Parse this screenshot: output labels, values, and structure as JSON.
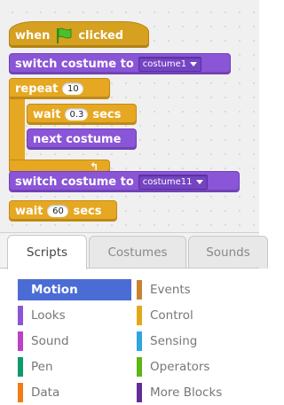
{
  "script": {
    "hat": {
      "when": "when",
      "clicked": "clicked"
    },
    "switch1": {
      "label": "switch costume to",
      "costume": "costume1"
    },
    "repeat": {
      "label": "repeat",
      "count": "10"
    },
    "wait_inner": {
      "label": "wait",
      "value": "0.3",
      "unit": "secs"
    },
    "next_costume": {
      "label": "next costume"
    },
    "switch2": {
      "label": "switch costume to",
      "costume": "costume11"
    },
    "wait_outer": {
      "label": "wait",
      "value": "60",
      "unit": "secs"
    }
  },
  "tabs": [
    {
      "label": "Scripts",
      "active": true
    },
    {
      "label": "Costumes",
      "active": false
    },
    {
      "label": "Sounds",
      "active": false
    }
  ],
  "categories": [
    {
      "label": "Motion",
      "color": "#4a6cd4",
      "active": true
    },
    {
      "label": "Events",
      "color": "#c88330"
    },
    {
      "label": "Looks",
      "color": "#8a55d7"
    },
    {
      "label": "Control",
      "color": "#e1a91a"
    },
    {
      "label": "Sound",
      "color": "#bb42c3"
    },
    {
      "label": "Sensing",
      "color": "#2ca5e2"
    },
    {
      "label": "Pen",
      "color": "#0e9a6c"
    },
    {
      "label": "Operators",
      "color": "#5cb712"
    },
    {
      "label": "Data",
      "color": "#ee7d16"
    },
    {
      "label": "More Blocks",
      "color": "#632d99"
    }
  ],
  "colors": {
    "control": "#e6a822",
    "looks": "#8a55d7",
    "flag": "#4cbf2a"
  }
}
